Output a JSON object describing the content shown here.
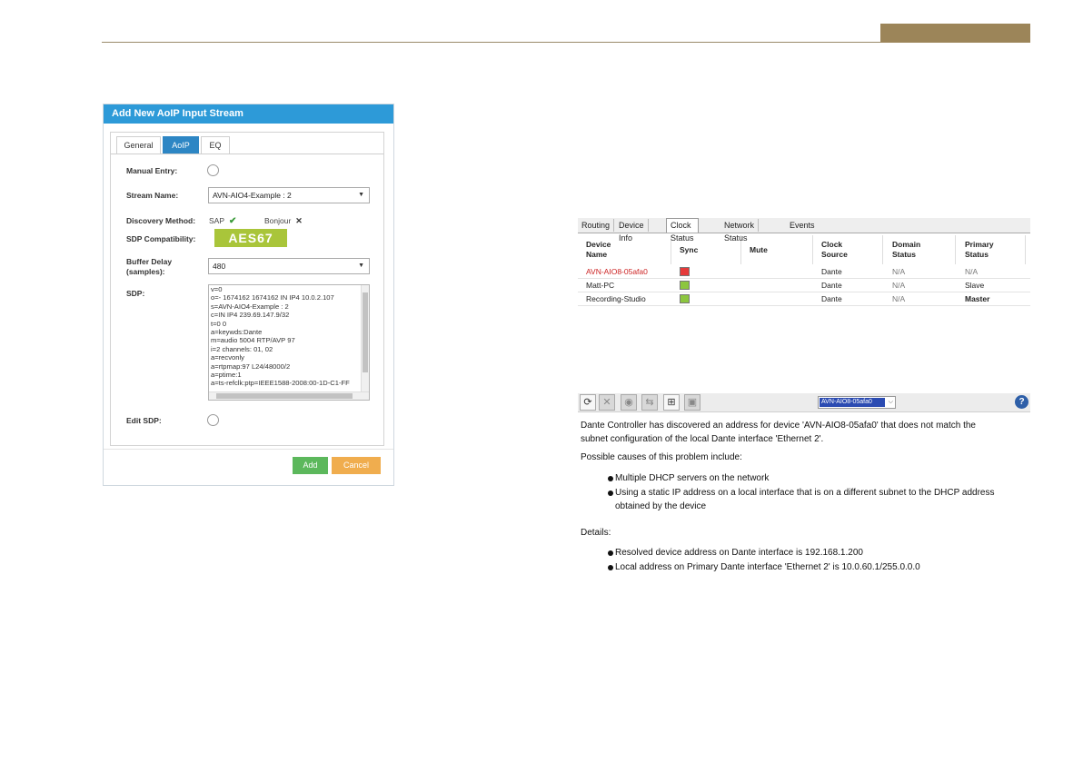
{
  "dialog": {
    "title": "Add New AoIP Input Stream",
    "tabs": [
      "General",
      "AoIP",
      "EQ"
    ],
    "active_tab": "AoIP",
    "manual_entry_label": "Manual Entry:",
    "stream_name_label": "Stream Name:",
    "stream_name_value": "AVN-AIO4-Example : 2",
    "discovery_label": "Discovery Method:",
    "sap_label": "SAP",
    "bonjour_label": "Bonjour",
    "sdp_compat_label": "SDP Compatibility:",
    "aes67_badge": "AES67",
    "buffer_label_line1": "Buffer Delay",
    "buffer_label_line2": "(samples):",
    "buffer_value": "480",
    "sdp_label": "SDP:",
    "sdp_lines": [
      "v=0",
      "o=- 1674162 1674162 IN IP4 10.0.2.107",
      "s=AVN-AIO4-Example : 2",
      "c=IN IP4 239.69.147.9/32",
      "t=0 0",
      "a=keywds:Dante",
      "m=audio 5004 RTP/AVP 97",
      "i=2 channels: 01, 02",
      "a=recvonly",
      "a=rtpmap:97 L24/48000/2",
      "a=ptime:1",
      "a=ts-refclk:ptp=IEEE1588-2008:00-1D-C1-FF"
    ],
    "edit_sdp_label": "Edit SDP:",
    "add_label": "Add",
    "cancel_label": "Cancel"
  },
  "clock": {
    "tabs": [
      "Routing",
      "Device Info",
      "Clock Status",
      "Network Status",
      "Events"
    ],
    "active_tab": "Clock Status",
    "headers": [
      [
        "Device",
        "Name"
      ],
      [
        "Sync",
        ""
      ],
      [
        "Mute",
        ""
      ],
      [
        "Clock",
        "Source"
      ],
      [
        "Domain",
        "Status"
      ],
      [
        "Primary",
        "Status"
      ]
    ],
    "rows": [
      {
        "name": "AVN-AIO8-05afa0",
        "sync": "red",
        "source": "Dante",
        "domain": "N/A",
        "primary": "N/A"
      },
      {
        "name": "Matt-PC",
        "sync": "green",
        "source": "Dante",
        "domain": "N/A",
        "primary": "Slave"
      },
      {
        "name": "Recording-Studio",
        "sync": "green",
        "source": "Dante",
        "domain": "N/A",
        "primary": "Master"
      }
    ],
    "colors": {
      "sync_red": "#e53a3a",
      "sync_green": "#8cc63f",
      "error_text": "#cc2222"
    }
  },
  "dante": {
    "device_select": "AVN-AIO8-05afa0",
    "help_label": "?",
    "message_line1": "Dante Controller has discovered an address for device 'AVN-AIO8-05afa0' that does not match the",
    "message_line2": "subnet configuration of the local Dante interface 'Ethernet 2'.",
    "causes_intro": "Possible causes of this problem include:",
    "cause_1": "Multiple DHCP servers on the network",
    "cause_2_line1": "Using a static IP address on a local interface that is on a different subnet to the DHCP address",
    "cause_2_line2": "obtained by the device",
    "details_label": "Details:",
    "detail_1": "Resolved device address on Dante interface is 192.168.1.200",
    "detail_2": "Local address on Primary Dante interface 'Ethernet 2' is 10.0.60.1/255.0.0.0"
  }
}
